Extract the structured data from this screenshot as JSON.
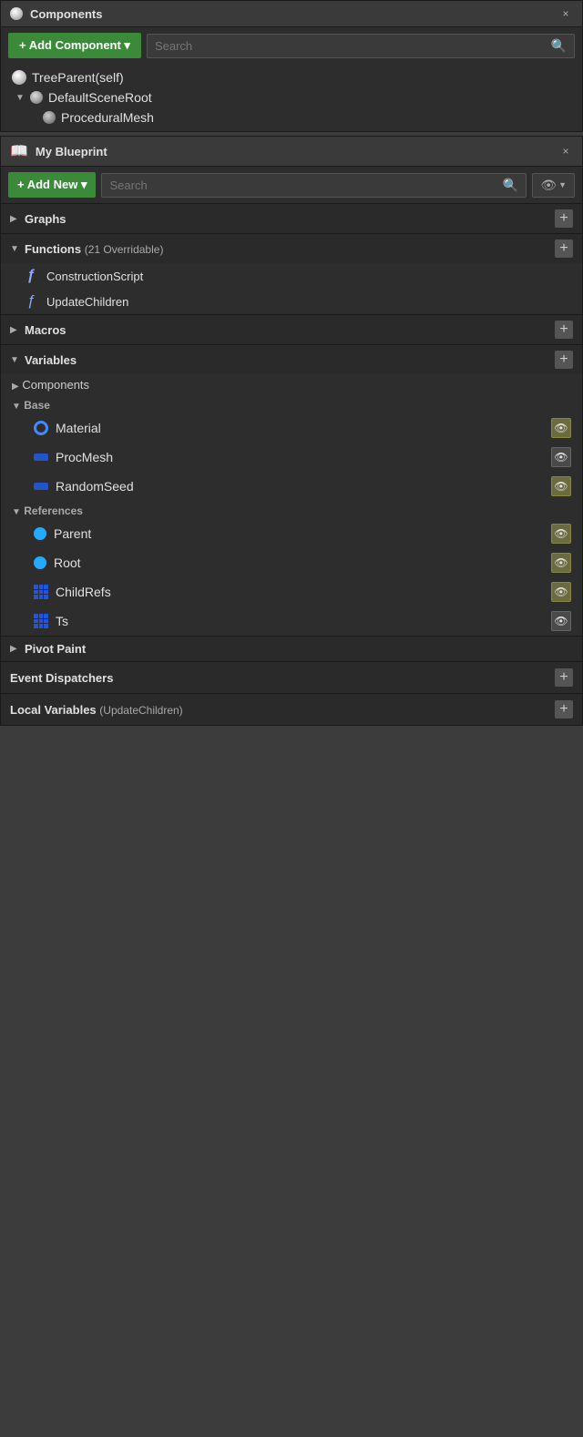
{
  "components_panel": {
    "title": "Components",
    "add_button": "+ Add Component ▾",
    "search_placeholder": "Search",
    "tree": [
      {
        "label": "TreeParent(self)",
        "indent": 0,
        "type": "sphere",
        "has_arrow": false
      },
      {
        "label": "DefaultSceneRoot",
        "indent": 1,
        "type": "sphere",
        "has_arrow": true
      },
      {
        "label": "ProceduralMesh",
        "indent": 2,
        "type": "sphere-small",
        "has_arrow": false
      }
    ]
  },
  "blueprint_panel": {
    "title": "My Blueprint",
    "add_button": "+ Add New ▾",
    "search_placeholder": "Search",
    "sections": {
      "graphs": {
        "label": "Graphs",
        "expanded": false
      },
      "functions": {
        "label": "Functions",
        "subtitle": "(21 Overridable)",
        "expanded": true,
        "items": [
          {
            "label": "ConstructionScript",
            "type": "construction"
          },
          {
            "label": "UpdateChildren",
            "type": "function"
          }
        ]
      },
      "macros": {
        "label": "Macros",
        "expanded": false
      },
      "variables": {
        "label": "Variables",
        "expanded": true,
        "groups": {
          "components": {
            "label": "Components"
          },
          "base": {
            "label": "Base",
            "items": [
              {
                "label": "Material",
                "type": "circle-outline",
                "eye": "yellow"
              },
              {
                "label": "ProcMesh",
                "type": "bar-blue",
                "eye": "dark"
              },
              {
                "label": "RandomSeed",
                "type": "bar-blue",
                "eye": "yellow"
              }
            ]
          },
          "references": {
            "label": "References",
            "items": [
              {
                "label": "Parent",
                "type": "circle-cyan",
                "eye": "yellow"
              },
              {
                "label": "Root",
                "type": "circle-cyan",
                "eye": "yellow"
              },
              {
                "label": "ChildRefs",
                "type": "grid",
                "eye": "yellow"
              },
              {
                "label": "Ts",
                "type": "grid",
                "eye": "dark"
              }
            ]
          }
        }
      },
      "pivot_paint": {
        "label": "Pivot Paint",
        "expanded": false
      },
      "event_dispatchers": {
        "label": "Event Dispatchers"
      },
      "local_variables": {
        "label": "Local Variables",
        "subtitle": "(UpdateChildren)"
      }
    }
  },
  "icons": {
    "close": "×",
    "search": "🔍",
    "eye": "👁",
    "plus": "+",
    "arrow_down": "▼",
    "arrow_right": "▶"
  }
}
